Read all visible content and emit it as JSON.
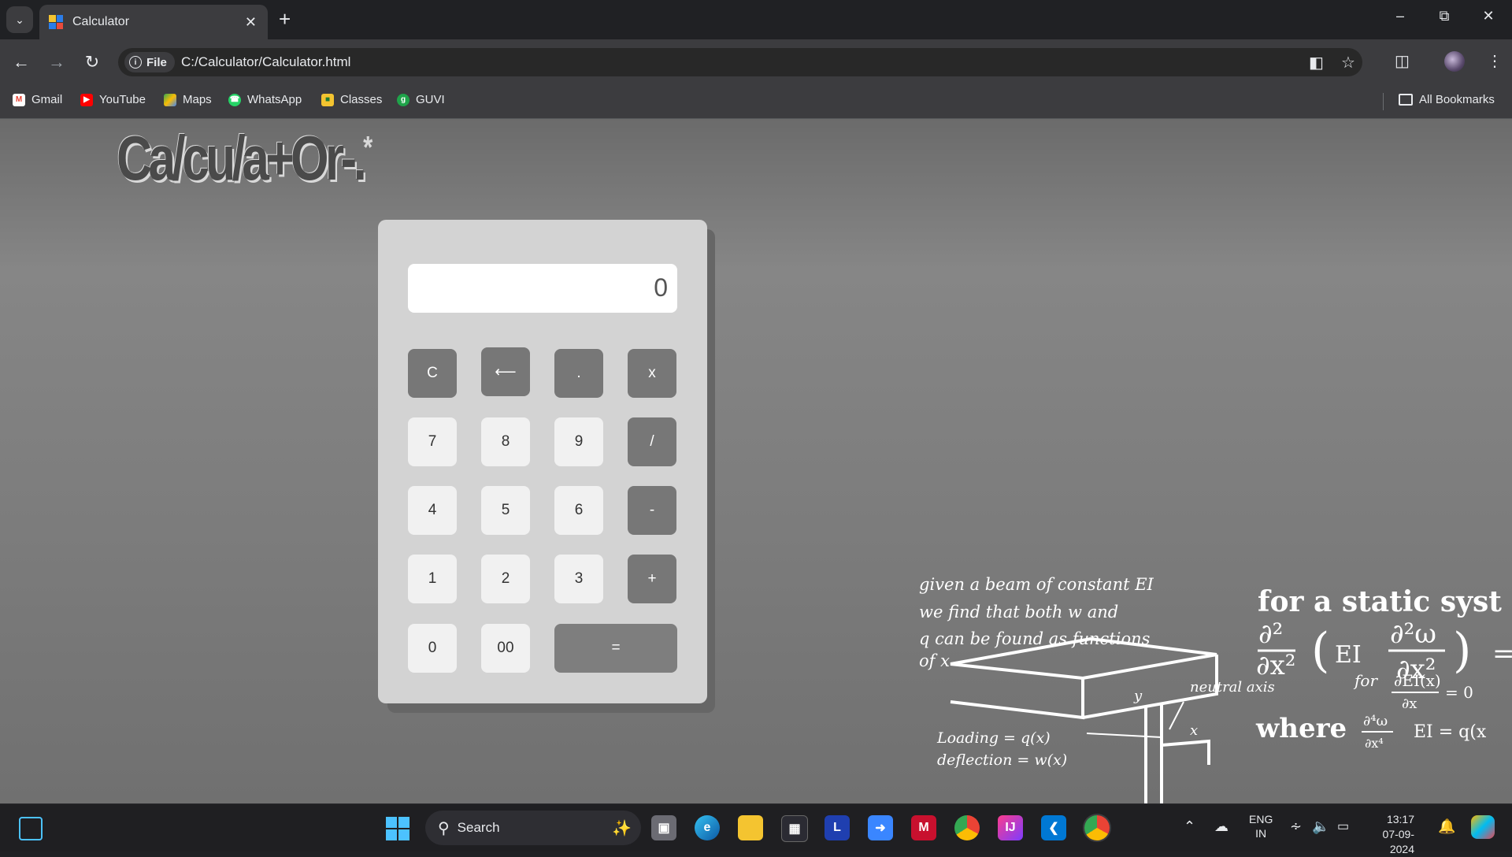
{
  "browser": {
    "tab_title": "Calculator",
    "url_chip": "File",
    "url": "C:/Calculator/Calculator.html"
  },
  "bookmarks": [
    {
      "label": "Gmail",
      "icon": "gmail-icon"
    },
    {
      "label": "YouTube",
      "icon": "youtube-icon"
    },
    {
      "label": "Maps",
      "icon": "maps-icon"
    },
    {
      "label": "WhatsApp",
      "icon": "whatsapp-icon"
    },
    {
      "label": "Classes",
      "icon": "classes-icon"
    },
    {
      "label": "GUVI",
      "icon": "guvi-icon"
    }
  ],
  "all_bookmarks": "All Bookmarks",
  "page": {
    "logo_text": "Ca/cu/a+Or-.",
    "logo_star": "*",
    "display_value": "0",
    "keys": {
      "clear": "C",
      "backspace": "⟵",
      "dot": ".",
      "multiply": "x",
      "seven": "7",
      "eight": "8",
      "nine": "9",
      "divide": "/",
      "four": "4",
      "five": "5",
      "six": "6",
      "minus": "-",
      "one": "1",
      "two": "2",
      "three": "3",
      "plus": "+",
      "zero": "0",
      "double_zero": "00",
      "equals": "="
    },
    "chalkboard": {
      "line1": "given a beam of constant EI",
      "line2": "we find that both w and",
      "line3": "q can be found as functions",
      "line4": "of x",
      "loading": "Loading = q(x)",
      "deflection": "deflection = w(x)",
      "neutral_axis": "neutral axis",
      "axis_y": "y",
      "axis_x": "x",
      "heading": "for a static syst",
      "where": "where",
      "for_word": "for",
      "ei_eq": "EI = q(x"
    }
  },
  "taskbar": {
    "search_placeholder": "Search",
    "lang_top": "ENG",
    "lang_bottom": "IN",
    "time": "13:17",
    "date": "07-09-2024"
  },
  "colors": {
    "calc_body": "#d3d3d3",
    "operator_key": "#777777",
    "number_key": "#f1f1f1",
    "page_bg": "#808080"
  }
}
